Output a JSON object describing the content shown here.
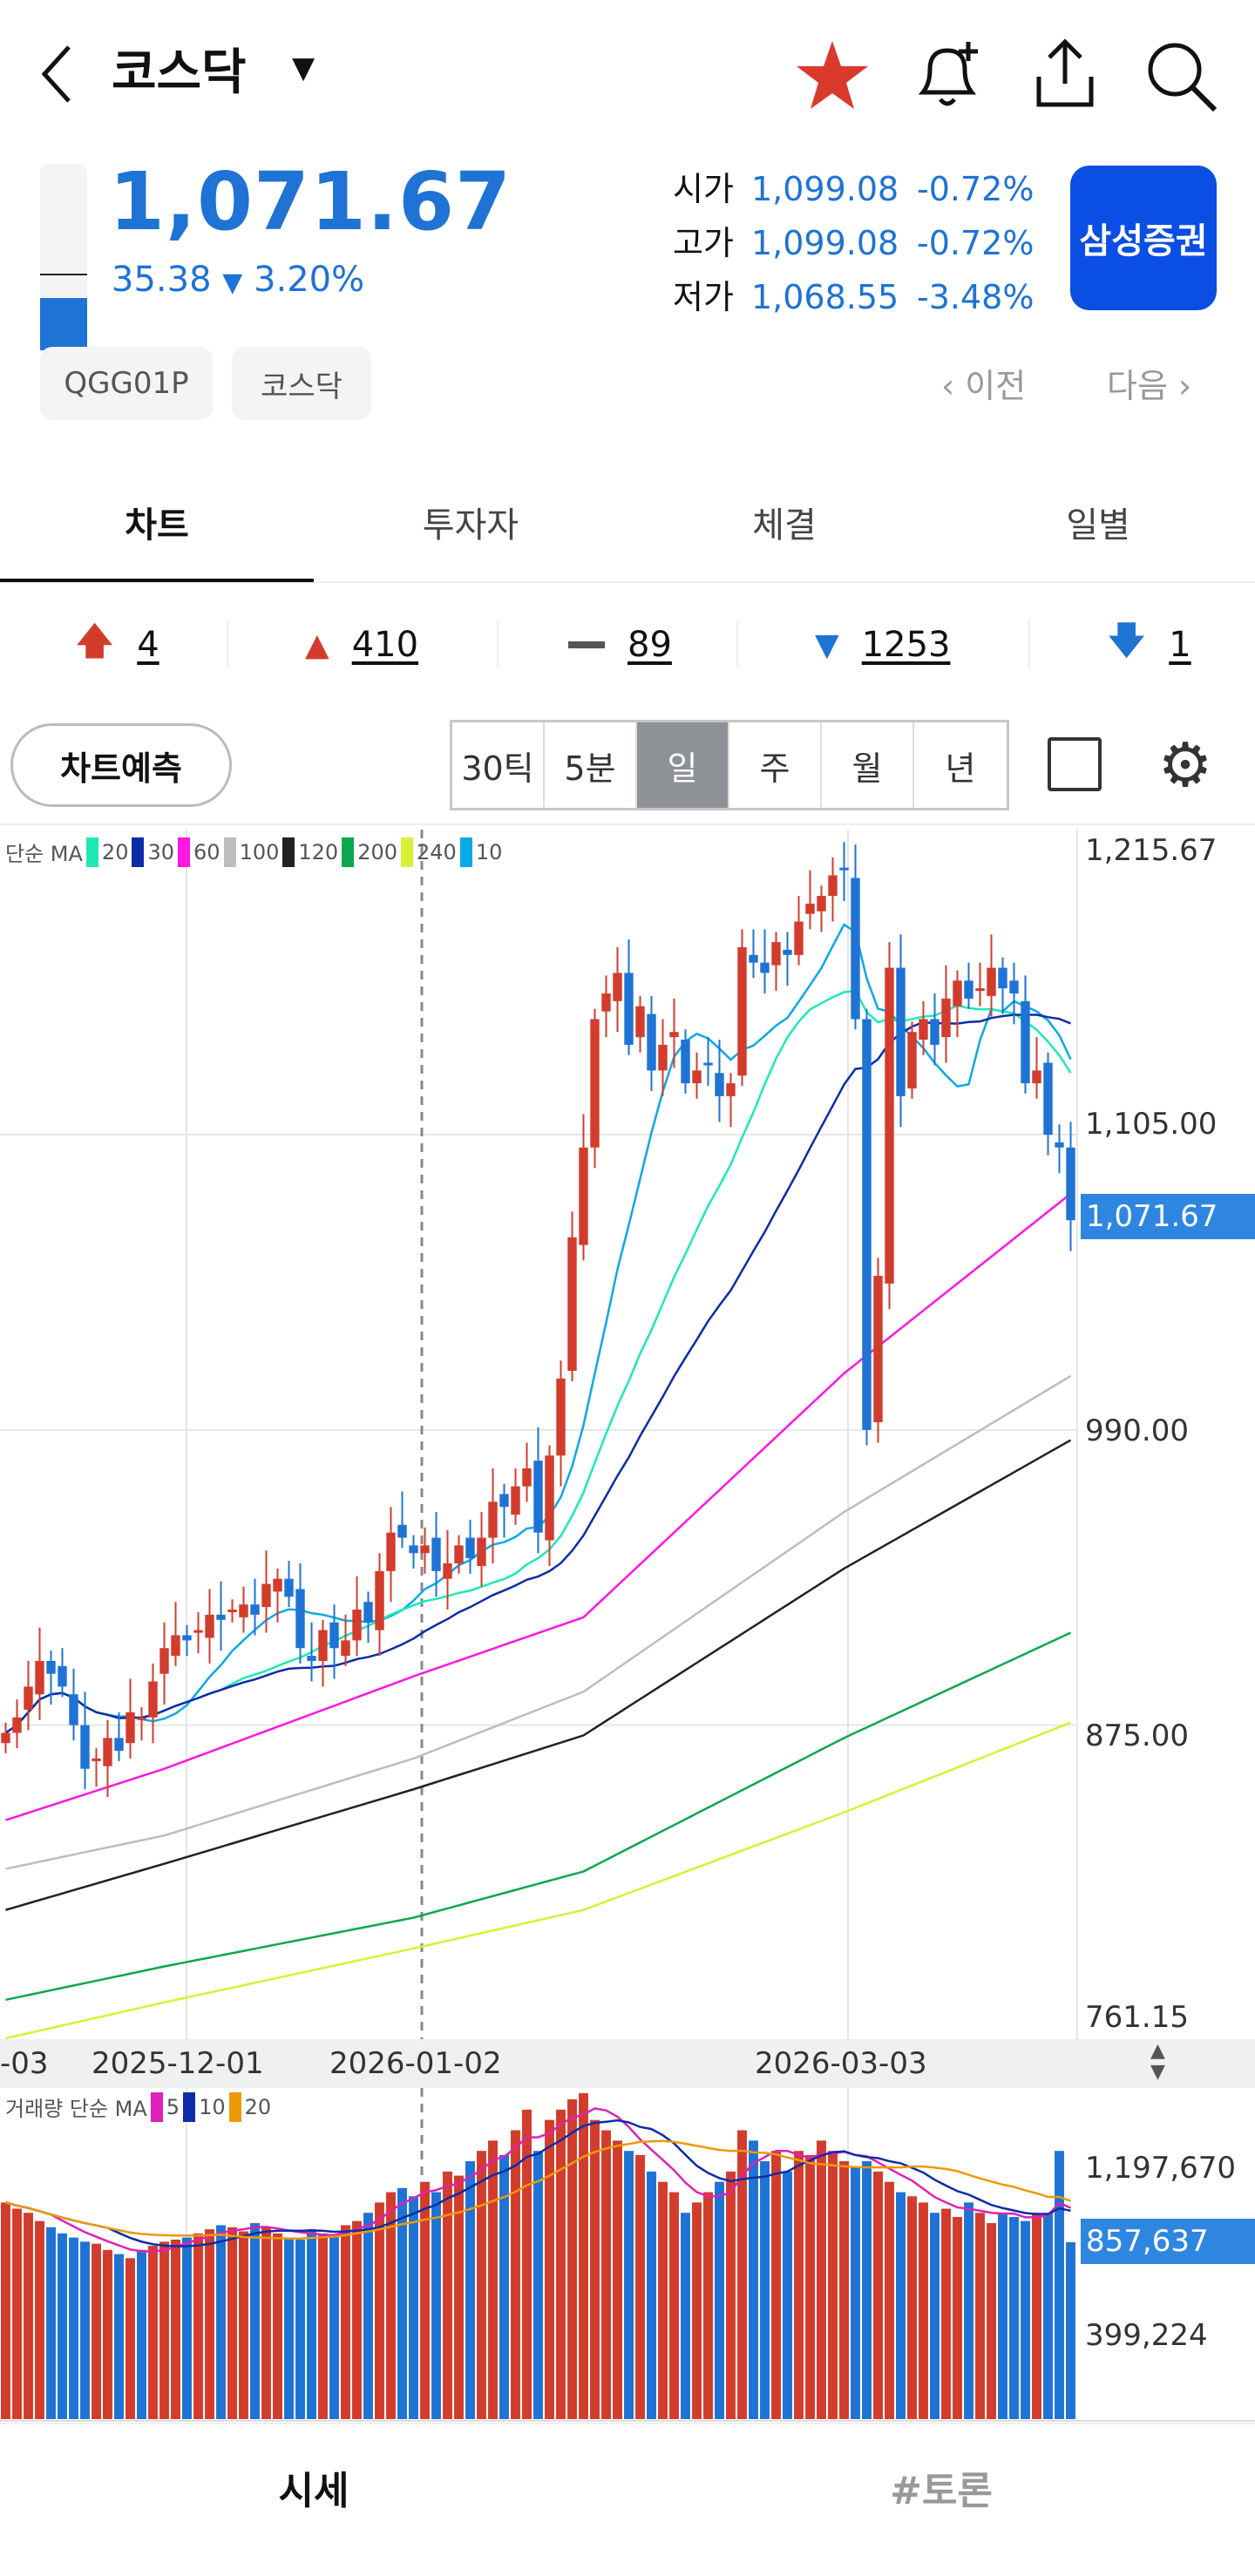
{
  "header": {
    "title": "코스닥",
    "back": "back-icon",
    "favorite_color": "#d93a2b"
  },
  "quote": {
    "price": "1,071.67",
    "change": "35.38",
    "change_pct": "3.20%",
    "open_label": "시가",
    "open": "1,099.08",
    "open_pct": "-0.72%",
    "high_label": "고가",
    "high": "1,099.08",
    "high_pct": "-0.72%",
    "low_label": "저가",
    "low": "1,068.55",
    "low_pct": "-3.48%",
    "broker": "삼성증권"
  },
  "chips": [
    "QGG01P",
    "코스닥"
  ],
  "pager": {
    "prev": "이전",
    "next": "다음"
  },
  "tabs": [
    "차트",
    "투자자",
    "체결",
    "일별"
  ],
  "breadth": {
    "upper_limit": "4",
    "up": "410",
    "flat": "89",
    "down": "1253",
    "lower_limit": "1"
  },
  "controls": {
    "predict": "차트예측",
    "periods": [
      "30틱",
      "5분",
      "일",
      "주",
      "월",
      "년"
    ],
    "selected": "일"
  },
  "legend": {
    "label": "단순 MA",
    "items": [
      {
        "n": "20",
        "c": "#1de9b6"
      },
      {
        "n": "30",
        "c": "#0d2ca8"
      },
      {
        "n": "60",
        "c": "#ff16e0"
      },
      {
        "n": "100",
        "c": "#bdbdbd"
      },
      {
        "n": "120",
        "c": "#222222"
      },
      {
        "n": "200",
        "c": "#0aa84f"
      },
      {
        "n": "240",
        "c": "#d8f034"
      },
      {
        "n": "10",
        "c": "#0ba8e8"
      }
    ]
  },
  "vol_legend": {
    "label": "거래량 단순 MA",
    "items": [
      {
        "n": "5",
        "c": "#e020b8"
      },
      {
        "n": "10",
        "c": "#0d2ca8"
      },
      {
        "n": "20",
        "c": "#ec9a0c"
      }
    ]
  },
  "price_axis": [
    "1,215.67",
    "1,105.00",
    "990.00",
    "875.00",
    "761.15"
  ],
  "current_price_label": "1,071.67",
  "dates": [
    "-03",
    "2025-12-01",
    "2026-01-02",
    "2026-03-03"
  ],
  "vol_axis": [
    "1,197,670",
    "399,224"
  ],
  "current_volume_label": "857,637",
  "bottom_nav": [
    "시세",
    "#토론"
  ],
  "chart_data": {
    "type": "candlestick",
    "ylim": [
      761.15,
      1215.67
    ],
    "up_color": "#d23c2c",
    "down_color": "#1e73d4",
    "closes": [
      872,
      878,
      890,
      900,
      895,
      890,
      875,
      858,
      862,
      870,
      865,
      880,
      878,
      892,
      905,
      910,
      908,
      912,
      918,
      916,
      920,
      922,
      918,
      930,
      932,
      925,
      905,
      900,
      912,
      905,
      908,
      920,
      915,
      935,
      950,
      948,
      942,
      945,
      935,
      938,
      945,
      940,
      948,
      962,
      960,
      968,
      975,
      950,
      980,
      1010,
      1065,
      1100,
      1150,
      1160,
      1168,
      1140,
      1155,
      1130,
      1140,
      1145,
      1125,
      1130,
      1132,
      1120,
      1125,
      1178,
      1172,
      1168,
      1180,
      1175,
      1188,
      1195,
      1198,
      1206,
      1208,
      1150,
      990,
      1050,
      1170,
      1120,
      1145,
      1150,
      1140,
      1158,
      1165,
      1158,
      1162,
      1170,
      1162,
      1160,
      1125,
      1130,
      1105,
      1100,
      1071.67
    ],
    "long_ma": {
      "index": [
        0,
        14,
        36,
        51,
        74,
        94
      ],
      "ma60": [
        838,
        858,
        894,
        917,
        1012,
        1082
      ],
      "ma100": [
        819,
        832,
        862,
        888,
        958,
        1011
      ],
      "ma120": [
        803,
        821,
        850,
        871,
        936,
        986
      ],
      "ma200": [
        768,
        781,
        800,
        818,
        870,
        911
      ],
      "ma240": [
        753,
        767,
        788,
        803,
        841,
        876
      ]
    },
    "volume_k": [
      1050,
      1020,
      1000,
      960,
      930,
      900,
      880,
      860,
      850,
      820,
      800,
      780,
      820,
      840,
      860,
      870,
      880,
      900,
      920,
      940,
      930,
      910,
      950,
      930,
      900,
      880,
      870,
      920,
      900,
      890,
      940,
      960,
      1000,
      1050,
      1100,
      1120,
      1080,
      1150,
      1100,
      1200,
      1180,
      1250,
      1300,
      1350,
      1280,
      1400,
      1500,
      1300,
      1450,
      1500,
      1550,
      1580,
      1450,
      1400,
      1350,
      1300,
      1280,
      1200,
      1150,
      1100,
      1000,
      1050,
      1100,
      1150,
      1200,
      1400,
      1350,
      1250,
      1300,
      1200,
      1300,
      1280,
      1350,
      1300,
      1250,
      1220,
      1250,
      1200,
      1150,
      1100,
      1080,
      1050,
      1000,
      1020,
      980,
      1050,
      1000,
      950,
      1000,
      980,
      960,
      1000,
      1000,
      1300,
      857.637
    ],
    "vol_ylim": [
      0,
      1588
    ]
  }
}
